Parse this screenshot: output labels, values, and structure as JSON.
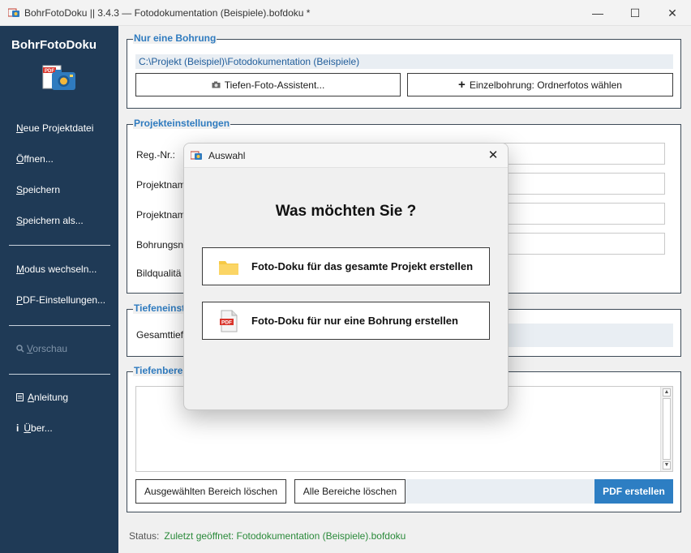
{
  "window": {
    "title": "BohrFotoDoku || 3.4.3 — Fotodokumentation (Beispiele).bofdoku *",
    "minimize_glyph": "—",
    "maximize_glyph": "☐",
    "close_glyph": "✕"
  },
  "sidebar": {
    "brand": "BohrFotoDoku",
    "items": [
      {
        "label": "Neue Projektdatei",
        "underline": "N",
        "rest": "eue Projektdatei"
      },
      {
        "label": "Öffnen...",
        "underline": "Ö",
        "rest": "ffnen..."
      },
      {
        "label": "Speichern",
        "underline": "S",
        "rest": "peichern"
      },
      {
        "label": "Speichern als...",
        "underline": "S",
        "rest": "peichern als..."
      },
      {
        "label": "Modus wechseln...",
        "underline": "M",
        "rest": "odus wechseln..."
      },
      {
        "label": "PDF-Einstellungen...",
        "underline": "P",
        "rest": "DF-Einstellungen..."
      },
      {
        "label": "Vorschau",
        "underline": "V",
        "rest": "orschau"
      },
      {
        "label": "Anleitung",
        "underline": "A",
        "rest": "nleitung"
      },
      {
        "label": "Über...",
        "underline": "Ü",
        "rest": "ber..."
      }
    ]
  },
  "single_boring": {
    "title": "Nur eine Bohrung",
    "path": "C:\\Projekt (Beispiel)\\Fotodokumentation (Beispiele)",
    "depth_wizard_label": "Tiefen-Foto-Assistent...",
    "single_folder_label": "Einzelbohrung: Ordnerfotos wählen"
  },
  "project_settings": {
    "title": "Projekteinstellungen",
    "labels": [
      "Reg.-Nr.:",
      "Projektnam",
      "Projektnam",
      "Bohrungsn",
      "Bildqualitä"
    ]
  },
  "depth_settings": {
    "title": "Tiefeneinst",
    "label": "Gesamttief"
  },
  "depth_ranges": {
    "title": "Tiefenbere",
    "delete_selected_label": "Ausgewählten Bereich löschen",
    "delete_all_label": "Alle Bereiche löschen",
    "create_pdf_label": "PDF erstellen"
  },
  "status": {
    "label": "Status:",
    "value": "Zuletzt geöffnet: Fotodokumentation (Beispiele).bofdoku"
  },
  "dialog": {
    "title": "Auswahl",
    "close_glyph": "✕",
    "question": "Was möchten Sie ?",
    "option_project": "Foto-Doku für das gesamte Projekt erstellen",
    "option_single": "Foto-Doku für nur eine Bohrung erstellen"
  },
  "colors": {
    "sidebar": "#1f3a56",
    "accent": "#2f7bbf",
    "pdf_button": "#2d7ec3",
    "status_value": "#2a8a3a"
  },
  "icons": [
    "app-icon",
    "camera-icon",
    "plus-icon",
    "search-icon",
    "document-icon",
    "info-icon",
    "folder-icon",
    "pdf-file-icon",
    "close-icon"
  ]
}
